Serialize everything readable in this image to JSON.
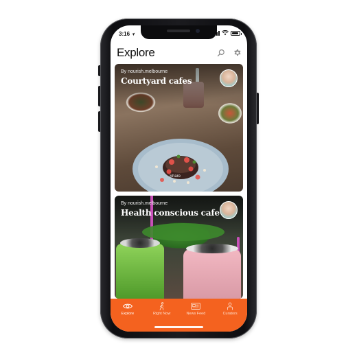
{
  "status_bar": {
    "time": "3:16"
  },
  "header": {
    "title": "Explore"
  },
  "cards": [
    {
      "byline": "By nourish.melbourne",
      "title": "Courtyard cafes",
      "overlay_text": "Share"
    },
    {
      "byline": "By nourish.melbourne",
      "title": "Health conscious cafe"
    }
  ],
  "tabs": [
    {
      "label": "Explore",
      "icon": "eye-icon",
      "active": true
    },
    {
      "label": "Right Now",
      "icon": "walking-person-icon",
      "active": false
    },
    {
      "label": "News Feed",
      "icon": "newspaper-icon",
      "active": false
    },
    {
      "label": "Curators",
      "icon": "person-icon",
      "active": false
    }
  ],
  "colors": {
    "accent": "#f4621f",
    "screen_bg": "#ffffff",
    "frame": "#111114"
  }
}
